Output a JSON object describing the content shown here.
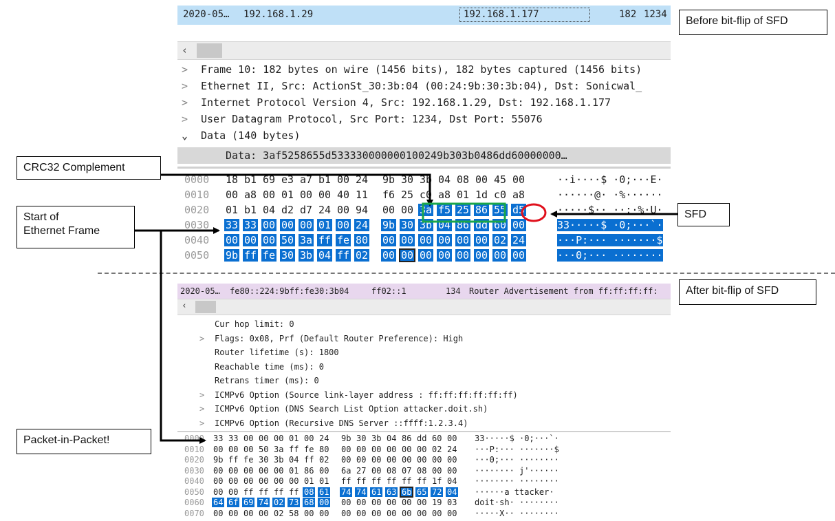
{
  "top": {
    "packet_row": {
      "time": "2020-05…",
      "src": "192.168.1.29",
      "dst": "192.168.1.177",
      "len": "182",
      "info": "1234"
    },
    "tree": [
      {
        "label": "Frame 10: 182 bytes on wire (1456 bits), 182 bytes captured (1456 bits)",
        "exp": ">"
      },
      {
        "label": "Ethernet II, Src: ActionSt_30:3b:04 (00:24:9b:30:3b:04), Dst: Sonicwal_",
        "exp": ">"
      },
      {
        "label": "Internet Protocol Version 4, Src: 192.168.1.29, Dst: 192.168.1.177",
        "exp": ">"
      },
      {
        "label": "User Datagram Protocol, Src Port: 1234, Dst Port: 55076",
        "exp": ">"
      },
      {
        "label": "Data (140 bytes)",
        "exp": "v"
      },
      {
        "label": "Data: 3af5258655d5333300000001002 49b303b0486dd60000000…",
        "exp": ""
      }
    ],
    "data_line": "Data: 3af5258655d53333000000010 0249b303b0486dd60000000…",
    "hex": [
      {
        "off": "0000",
        "bytes": "18 b1 69 e3 a7 b1 00 24  9b 30 3b 04 08 00 45 00",
        "ascii": "··i····$ ·0;···E·"
      },
      {
        "off": "0010",
        "bytes": "00 a8 00 01 00 00 40 11  f6 25 c0 a8 01 1d c0 a8",
        "ascii": "······@· ·%······"
      },
      {
        "off": "0020",
        "bytes": "01 b1 04 d2 d7 24 00 94  00 00 3a f5 25 86 55 d5",
        "ascii": "·····$·· ··:·%·U·"
      },
      {
        "off": "0030",
        "bytes": "33 33 00 00 00 01 00 24  9b 30 3b 04 86 dd 60 00",
        "ascii": "33·····$ ·0;···`·"
      },
      {
        "off": "0040",
        "bytes": "00 00 00 50 3a ff fe 80  00 00 00 00 00 00 02 24",
        "ascii": "···P:··· ·······$"
      },
      {
        "off": "0050",
        "bytes": "9b ff fe 30 3b 04 ff 02  00 00 00 00 00 00 00 00",
        "ascii": "···0;··· ········"
      }
    ]
  },
  "bottom": {
    "packet_row": {
      "time": "2020-05…",
      "src": "fe80::224:9bff:fe30:3b04",
      "dst": "ff02::1",
      "len": "134",
      "info": "Router Advertisement from ff:ff:ff:ff:"
    },
    "tree": [
      {
        "label": "Cur hop limit: 0",
        "exp": ""
      },
      {
        "label": "Flags: 0x08, Prf (Default Router Preference): High",
        "exp": ">"
      },
      {
        "label": "Router lifetime (s): 1800",
        "exp": ""
      },
      {
        "label": "Reachable time (ms): 0",
        "exp": ""
      },
      {
        "label": "Retrans timer (ms): 0",
        "exp": ""
      },
      {
        "label": "ICMPv6 Option (Source link-layer address : ff:ff:ff:ff:ff:ff)",
        "exp": ">"
      },
      {
        "label": "ICMPv6 Option (DNS Search List Option attacker.doit.sh)",
        "exp": ">"
      },
      {
        "label": "ICMPv6 Option (Recursive DNS Server ::ffff:1.2.3.4)",
        "exp": ">"
      }
    ],
    "hex": [
      {
        "off": "0000",
        "bytes": "33 33 00 00 00 01 00 24  9b 30 3b 04 86 dd 60 00",
        "ascii": "33·····$ ·0;···`·"
      },
      {
        "off": "0010",
        "bytes": "00 00 00 50 3a ff fe 80  00 00 00 00 00 00 02 24",
        "ascii": "···P:··· ·······$"
      },
      {
        "off": "0020",
        "bytes": "9b ff fe 30 3b 04 ff 02  00 00 00 00 00 00 00 00",
        "ascii": "···0;··· ········"
      },
      {
        "off": "0030",
        "bytes": "00 00 00 00 00 01 86 00  6a 27 00 08 07 08 00 00",
        "ascii": "········ j'······"
      },
      {
        "off": "0040",
        "bytes": "00 00 00 00 00 00 01 01  ff ff ff ff ff ff 1f 04",
        "ascii": "········ ········"
      },
      {
        "off": "0050",
        "bytes": "00 00 ff ff ff ff 08 61  74 74 61 63 6b 65 72 04",
        "ascii": "······a ttacker·"
      },
      {
        "off": "0060",
        "bytes": "64 6f 69 74 02 73 68 00  00 00 00 00 00 00 19 03",
        "ascii": "doit·sh· ········"
      },
      {
        "off": "0070",
        "bytes": "00 00 00 00 02 58 00 00  00 00 00 00 00 00 00 00",
        "ascii": "·····X·· ········"
      }
    ]
  },
  "callouts": {
    "before": "Before bit-flip of SFD",
    "after": "After bit-flip of SFD",
    "crc": "CRC32 Complement",
    "start": "Start of\nEthernet Frame",
    "sfd": "SFD",
    "pip": "Packet-in-Packet!"
  },
  "colors": {
    "selection": "#0a6fd1",
    "top_row": "#bfe0f7",
    "bottom_row": "#e8d7ee",
    "crc_box": "#1aa64a",
    "sfd_circle": "#e0101c"
  }
}
